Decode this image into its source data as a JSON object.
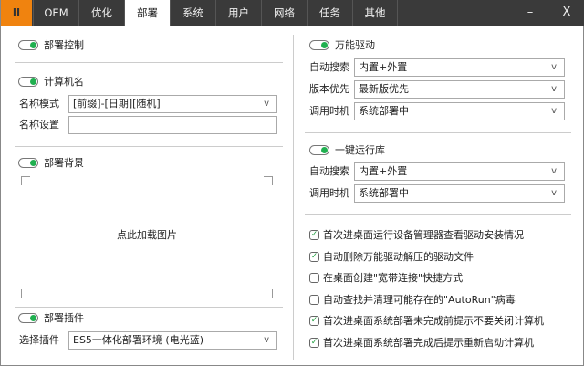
{
  "tabs": {
    "logo": "II",
    "items": [
      "OEM",
      "优化",
      "部署",
      "系统",
      "用户",
      "网络",
      "任务",
      "其他"
    ],
    "active": "部署",
    "minimize": "–",
    "close": "X"
  },
  "left": {
    "deploy_control": {
      "label": "部署控制",
      "on": true
    },
    "computer_name": {
      "label": "计算机名",
      "on": true,
      "mode_label": "名称模式",
      "mode_value": "[前缀]-[日期][随机]",
      "setting_label": "名称设置",
      "setting_value": ""
    },
    "background": {
      "label": "部署背景",
      "on": true,
      "load_text": "点此加载图片"
    },
    "plugin": {
      "label": "部署插件",
      "on": true,
      "select_label": "选择插件",
      "select_value": "ES5一体化部署环境 (电光蓝)"
    }
  },
  "right": {
    "driver": {
      "label": "万能驱动",
      "on": true,
      "rows": [
        {
          "label": "自动搜索",
          "value": "内置+外置"
        },
        {
          "label": "版本优先",
          "value": "最新版优先"
        },
        {
          "label": "调用时机",
          "value": "系统部署中"
        }
      ]
    },
    "runtime": {
      "label": "一键运行库",
      "on": true,
      "rows": [
        {
          "label": "自动搜索",
          "value": "内置+外置"
        },
        {
          "label": "调用时机",
          "value": "系统部署中"
        }
      ]
    },
    "checks": [
      {
        "label": "首次进桌面运行设备管理器查看驱动安装情况",
        "checked": true
      },
      {
        "label": "自动删除万能驱动解压的驱动文件",
        "checked": true
      },
      {
        "label": "在桌面创建\"宽带连接\"快捷方式",
        "checked": false
      },
      {
        "label": "自动查找并清理可能存在的\"AutoRun\"病毒",
        "checked": false
      },
      {
        "label": "首次进桌面系统部署未完成前提示不要关闭计算机",
        "checked": true
      },
      {
        "label": "首次进桌面系统部署完成后提示重新启动计算机",
        "checked": true
      }
    ]
  },
  "chevron": "v"
}
